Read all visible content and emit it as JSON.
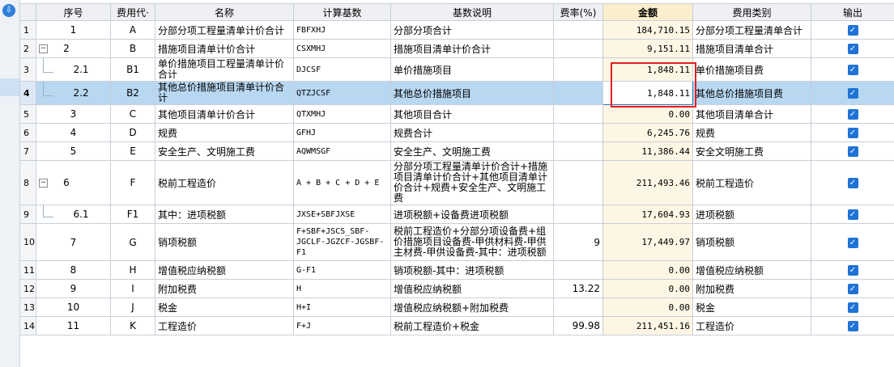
{
  "columns": {
    "seq": "序号",
    "code": "费用代·",
    "name": "名称",
    "base": "计算基数",
    "desc": "基数说明",
    "rate": "费率(%)",
    "amount": "金额",
    "category": "费用类别",
    "output": "输出"
  },
  "rows": [
    {
      "n": "1",
      "seq": "1",
      "code": "A",
      "name": "分部分项工程量清单计价合计",
      "base": "FBFXHJ",
      "desc": "分部分项合计",
      "rate": "",
      "amount": "184,710.15",
      "category": "分部分项工程量清单合计"
    },
    {
      "n": "2",
      "seq": "2",
      "code": "B",
      "name": "措施项目清单计价合计",
      "base": "CSXMHJ",
      "desc": "措施项目清单计价合计",
      "rate": "",
      "amount": "9,151.11",
      "category": "措施项目清单合计"
    },
    {
      "n": "3",
      "seq": "2.1",
      "code": "B1",
      "name": "单价措施项目工程量清单计价合计",
      "base": "DJCSF",
      "desc": "单价措施项目",
      "rate": "",
      "amount": "1,848.11",
      "category": "单价措施项目费"
    },
    {
      "n": "4",
      "seq": "2.2",
      "code": "B2",
      "name": "其他总价措施项目清单计价合计",
      "base": "QTZJCSF",
      "desc": "其他总价措施项目",
      "rate": "",
      "amount": "1,848.11",
      "category": "其他总价措施项目费"
    },
    {
      "n": "5",
      "seq": "3",
      "code": "C",
      "name": "其他项目清单计价合计",
      "base": "QTXMHJ",
      "desc": "其他项目合计",
      "rate": "",
      "amount": "0.00",
      "category": "其他项目清单合计"
    },
    {
      "n": "6",
      "seq": "4",
      "code": "D",
      "name": "规费",
      "base": "GFHJ",
      "desc": "规费合计",
      "rate": "",
      "amount": "6,245.76",
      "category": "规费"
    },
    {
      "n": "7",
      "seq": "5",
      "code": "E",
      "name": "安全生产、文明施工费",
      "base": "AQWMSGF",
      "desc": "安全生产、文明施工费",
      "rate": "",
      "amount": "11,386.44",
      "category": "安全文明施工费"
    },
    {
      "n": "8",
      "seq": "6",
      "code": "F",
      "name": "税前工程造价",
      "base": "A + B + C + D + E",
      "desc": "分部分项工程量清单计价合计+措施项目清单计价合计+其他项目清单计价合计+规费+安全生产、文明施工费",
      "rate": "",
      "amount": "211,493.46",
      "category": "税前工程造价"
    },
    {
      "n": "9",
      "seq": "6.1",
      "code": "F1",
      "name": "其中：进项税额",
      "base": "JXSE+SBFJXSE",
      "desc": "进项税额+设备费进项税额",
      "rate": "",
      "amount": "17,604.93",
      "category": "进项税额"
    },
    {
      "n": "10",
      "seq": "7",
      "code": "G",
      "name": "销项税额",
      "base": "F+SBF+JSCS_SBF-JGCLF-JGZCF-JGSBF-F1",
      "desc": "税前工程造价+分部分项设备费+组价措施项目设备费-甲供材料费-甲供主材费-甲供设备费-其中：进项税额",
      "rate": "9",
      "amount": "17,449.97",
      "category": "销项税额"
    },
    {
      "n": "11",
      "seq": "8",
      "code": "H",
      "name": "增值税应纳税额",
      "base": "G-F1",
      "desc": "销项税额-其中：进项税额",
      "rate": "",
      "amount": "0.00",
      "category": "增值税应纳税额"
    },
    {
      "n": "12",
      "seq": "9",
      "code": "I",
      "name": "附加税费",
      "base": "H",
      "desc": "增值税应纳税额",
      "rate": "13.22",
      "amount": "0.00",
      "category": "附加税费"
    },
    {
      "n": "13",
      "seq": "10",
      "code": "J",
      "name": "税金",
      "base": "H+I",
      "desc": "增值税应纳税额+附加税费",
      "rate": "",
      "amount": "0.00",
      "category": "税金"
    },
    {
      "n": "14",
      "seq": "11",
      "code": "K",
      "name": "工程造价",
      "base": "F+J",
      "desc": "税前工程造价+税金",
      "rate": "99.98",
      "amount": "211,451.16",
      "category": "工程造价"
    }
  ],
  "checkbox_color": "#1f73d6",
  "selected_row_color": "#b8d7f1",
  "highlight_color": "#e02020",
  "icons": {
    "download": "download-icon",
    "collapse": "minus-box-icon",
    "checked": "checkbox-checked-icon"
  },
  "glyphs": {
    "download": "⇩",
    "collapse": "−",
    "checked": "✓",
    "close": "×"
  }
}
